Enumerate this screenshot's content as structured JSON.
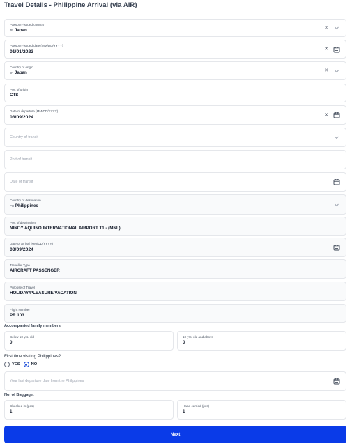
{
  "page": {
    "title": "Travel Details - Philippine Arrival (via AIR)"
  },
  "fields": {
    "passport_country": {
      "label": "Passport-issued country",
      "flag": "JP",
      "value": "Japan"
    },
    "passport_date": {
      "label": "Passport-issued date (MM/DD/YYYY)",
      "value": "01/01/2023"
    },
    "country_origin": {
      "label": "Country of origin",
      "flag": "JP",
      "value": "Japan"
    },
    "port_origin": {
      "label": "Port of origin",
      "value": "CTS"
    },
    "departure_date": {
      "label": "Date of departure (MM/DD/YYYY)",
      "value": "03/09/2024"
    },
    "country_transit": {
      "placeholder": "Country of transit"
    },
    "port_transit": {
      "placeholder": "Port of transit"
    },
    "date_transit": {
      "placeholder": "Date of transit"
    },
    "country_destination": {
      "label": "Country of destination",
      "flag": "PH",
      "value": "Philippines"
    },
    "port_destination": {
      "label": "Port of destination",
      "value": "NINOY AQUINO INTERNATIONAL AIRPORT T1 - (MNL)"
    },
    "arrival_date": {
      "label": "Date of arrival (MM/DD/YYYY)",
      "value": "03/09/2024"
    },
    "traveller_type": {
      "label": "Traveller Type",
      "value": "AIRCRAFT PASSENGER"
    },
    "purpose": {
      "label": "Purpose of Travel",
      "value": "HOLIDAY/PLEASURE/VACATION"
    },
    "flight_number": {
      "label": "Flight Number",
      "value": "PR 103"
    }
  },
  "family": {
    "heading": "Accompanied family members",
    "below": {
      "label": "Below 10 yrs. old",
      "value": "0"
    },
    "above": {
      "label": "10 yrs. old and above",
      "value": "0"
    }
  },
  "first_time": {
    "question": "First time visiting Philippines?",
    "yes_label": "YES",
    "no_label": "NO",
    "selected": "NO",
    "last_departure_placeholder": "Your last departure date from the Philippines"
  },
  "baggage": {
    "heading": "No. of Baggage:",
    "checked": {
      "label": "Checked-in (pcs)",
      "value": "1"
    },
    "hand": {
      "label": "Hand-carried (pcs)",
      "value": "1"
    }
  },
  "actions": {
    "next_label": "Next"
  },
  "colors": {
    "primary": "#0a3be8",
    "radio_accent": "#1d4ed8",
    "border": "#e5e7eb"
  }
}
